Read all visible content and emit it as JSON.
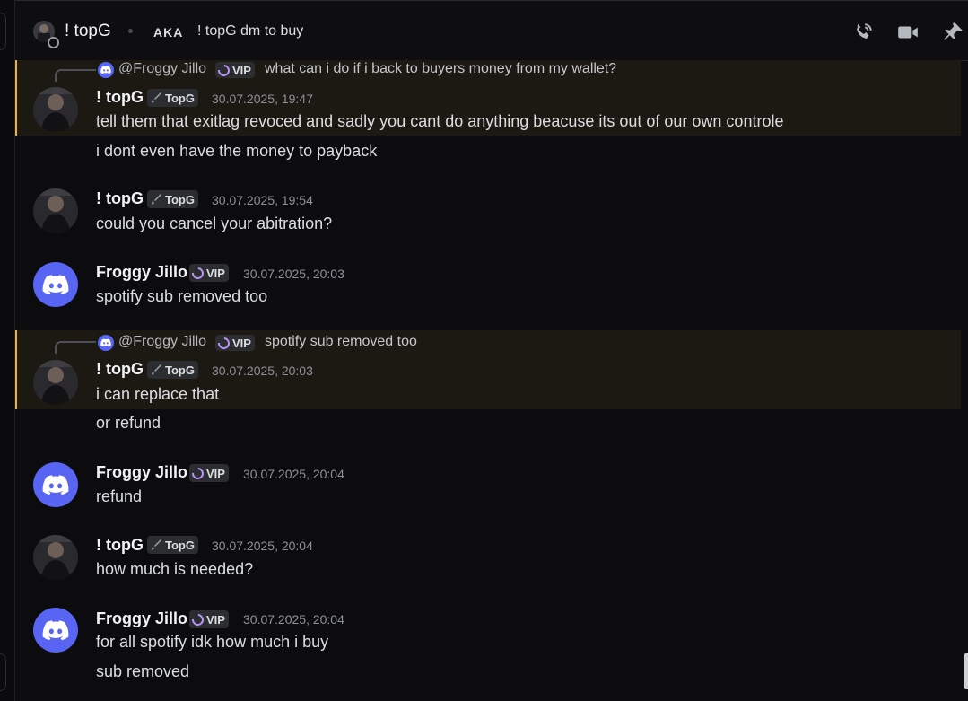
{
  "header": {
    "user_name": "! topG",
    "aka_label": "AKA",
    "aka_value": "! topG dm to buy",
    "icons": [
      "phone-call-icon",
      "video-call-icon",
      "pin-icon"
    ]
  },
  "tags": {
    "topg_tag": "TopG",
    "vip_tag": "VIP"
  },
  "messages": [
    {
      "reply_to": {
        "name": "@Froggy Jillo",
        "text": "what can i do if i back to buyers money from my wallet?"
      },
      "author": "! topG",
      "timestamp": "30.07.2025, 19:47",
      "lines": [
        "tell them that exitlag revoced and sadly you cant do anything beacuse its out of our own controle",
        "i dont even have the money to payback"
      ]
    },
    {
      "author": "! topG",
      "timestamp": "30.07.2025, 19:54",
      "lines": [
        "could you cancel your abitration?"
      ]
    },
    {
      "author": "Froggy Jillo",
      "timestamp": "30.07.2025, 20:03",
      "lines": [
        "spotify sub removed too"
      ]
    },
    {
      "reply_to": {
        "name": "@Froggy Jillo",
        "text": "spotify sub removed too"
      },
      "author": "! topG",
      "timestamp": "30.07.2025, 20:03",
      "lines": [
        "i can replace that",
        "or refund"
      ]
    },
    {
      "author": "Froggy Jillo",
      "timestamp": "30.07.2025, 20:04",
      "lines": [
        "refund"
      ]
    },
    {
      "author": "! topG",
      "timestamp": "30.07.2025, 20:04",
      "lines": [
        "how much is needed?"
      ]
    },
    {
      "author": "Froggy Jillo",
      "timestamp": "30.07.2025, 20:04",
      "lines": [
        "for all spotify idk how much i buy",
        "sub removed"
      ]
    }
  ],
  "colors": {
    "background": "#0c0c0f",
    "mention_highlight": "#1c1812",
    "mention_bar": "#f0b232",
    "discord_blurple": "#5865f2",
    "vip_icon": "#b794f6"
  }
}
